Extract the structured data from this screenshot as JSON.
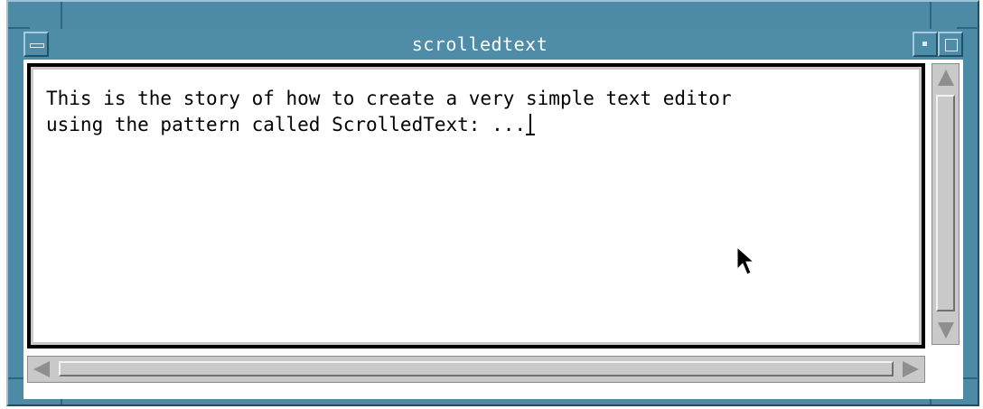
{
  "window": {
    "title": "scrolledtext"
  },
  "editor": {
    "line1": "This is the story of how to create a very simple text editor",
    "line2": "using the pattern called ScrolledText: ..."
  },
  "icons": {
    "window_menu": "window-menu-icon",
    "minimize": "minimize-icon",
    "maximize": "maximize-icon",
    "scroll_up": "arrow-up-icon",
    "scroll_down": "arrow-down-icon",
    "scroll_left": "arrow-left-icon",
    "scroll_right": "arrow-right-icon",
    "pointer": "mouse-pointer-icon",
    "text_cursor": "ibeam-cursor-icon"
  },
  "colors": {
    "frame": "#4d8aa6",
    "titlebar": "#4f8ca8",
    "text": "#000000",
    "background": "#ffffff",
    "scrollbar": "#c9c9c9"
  }
}
